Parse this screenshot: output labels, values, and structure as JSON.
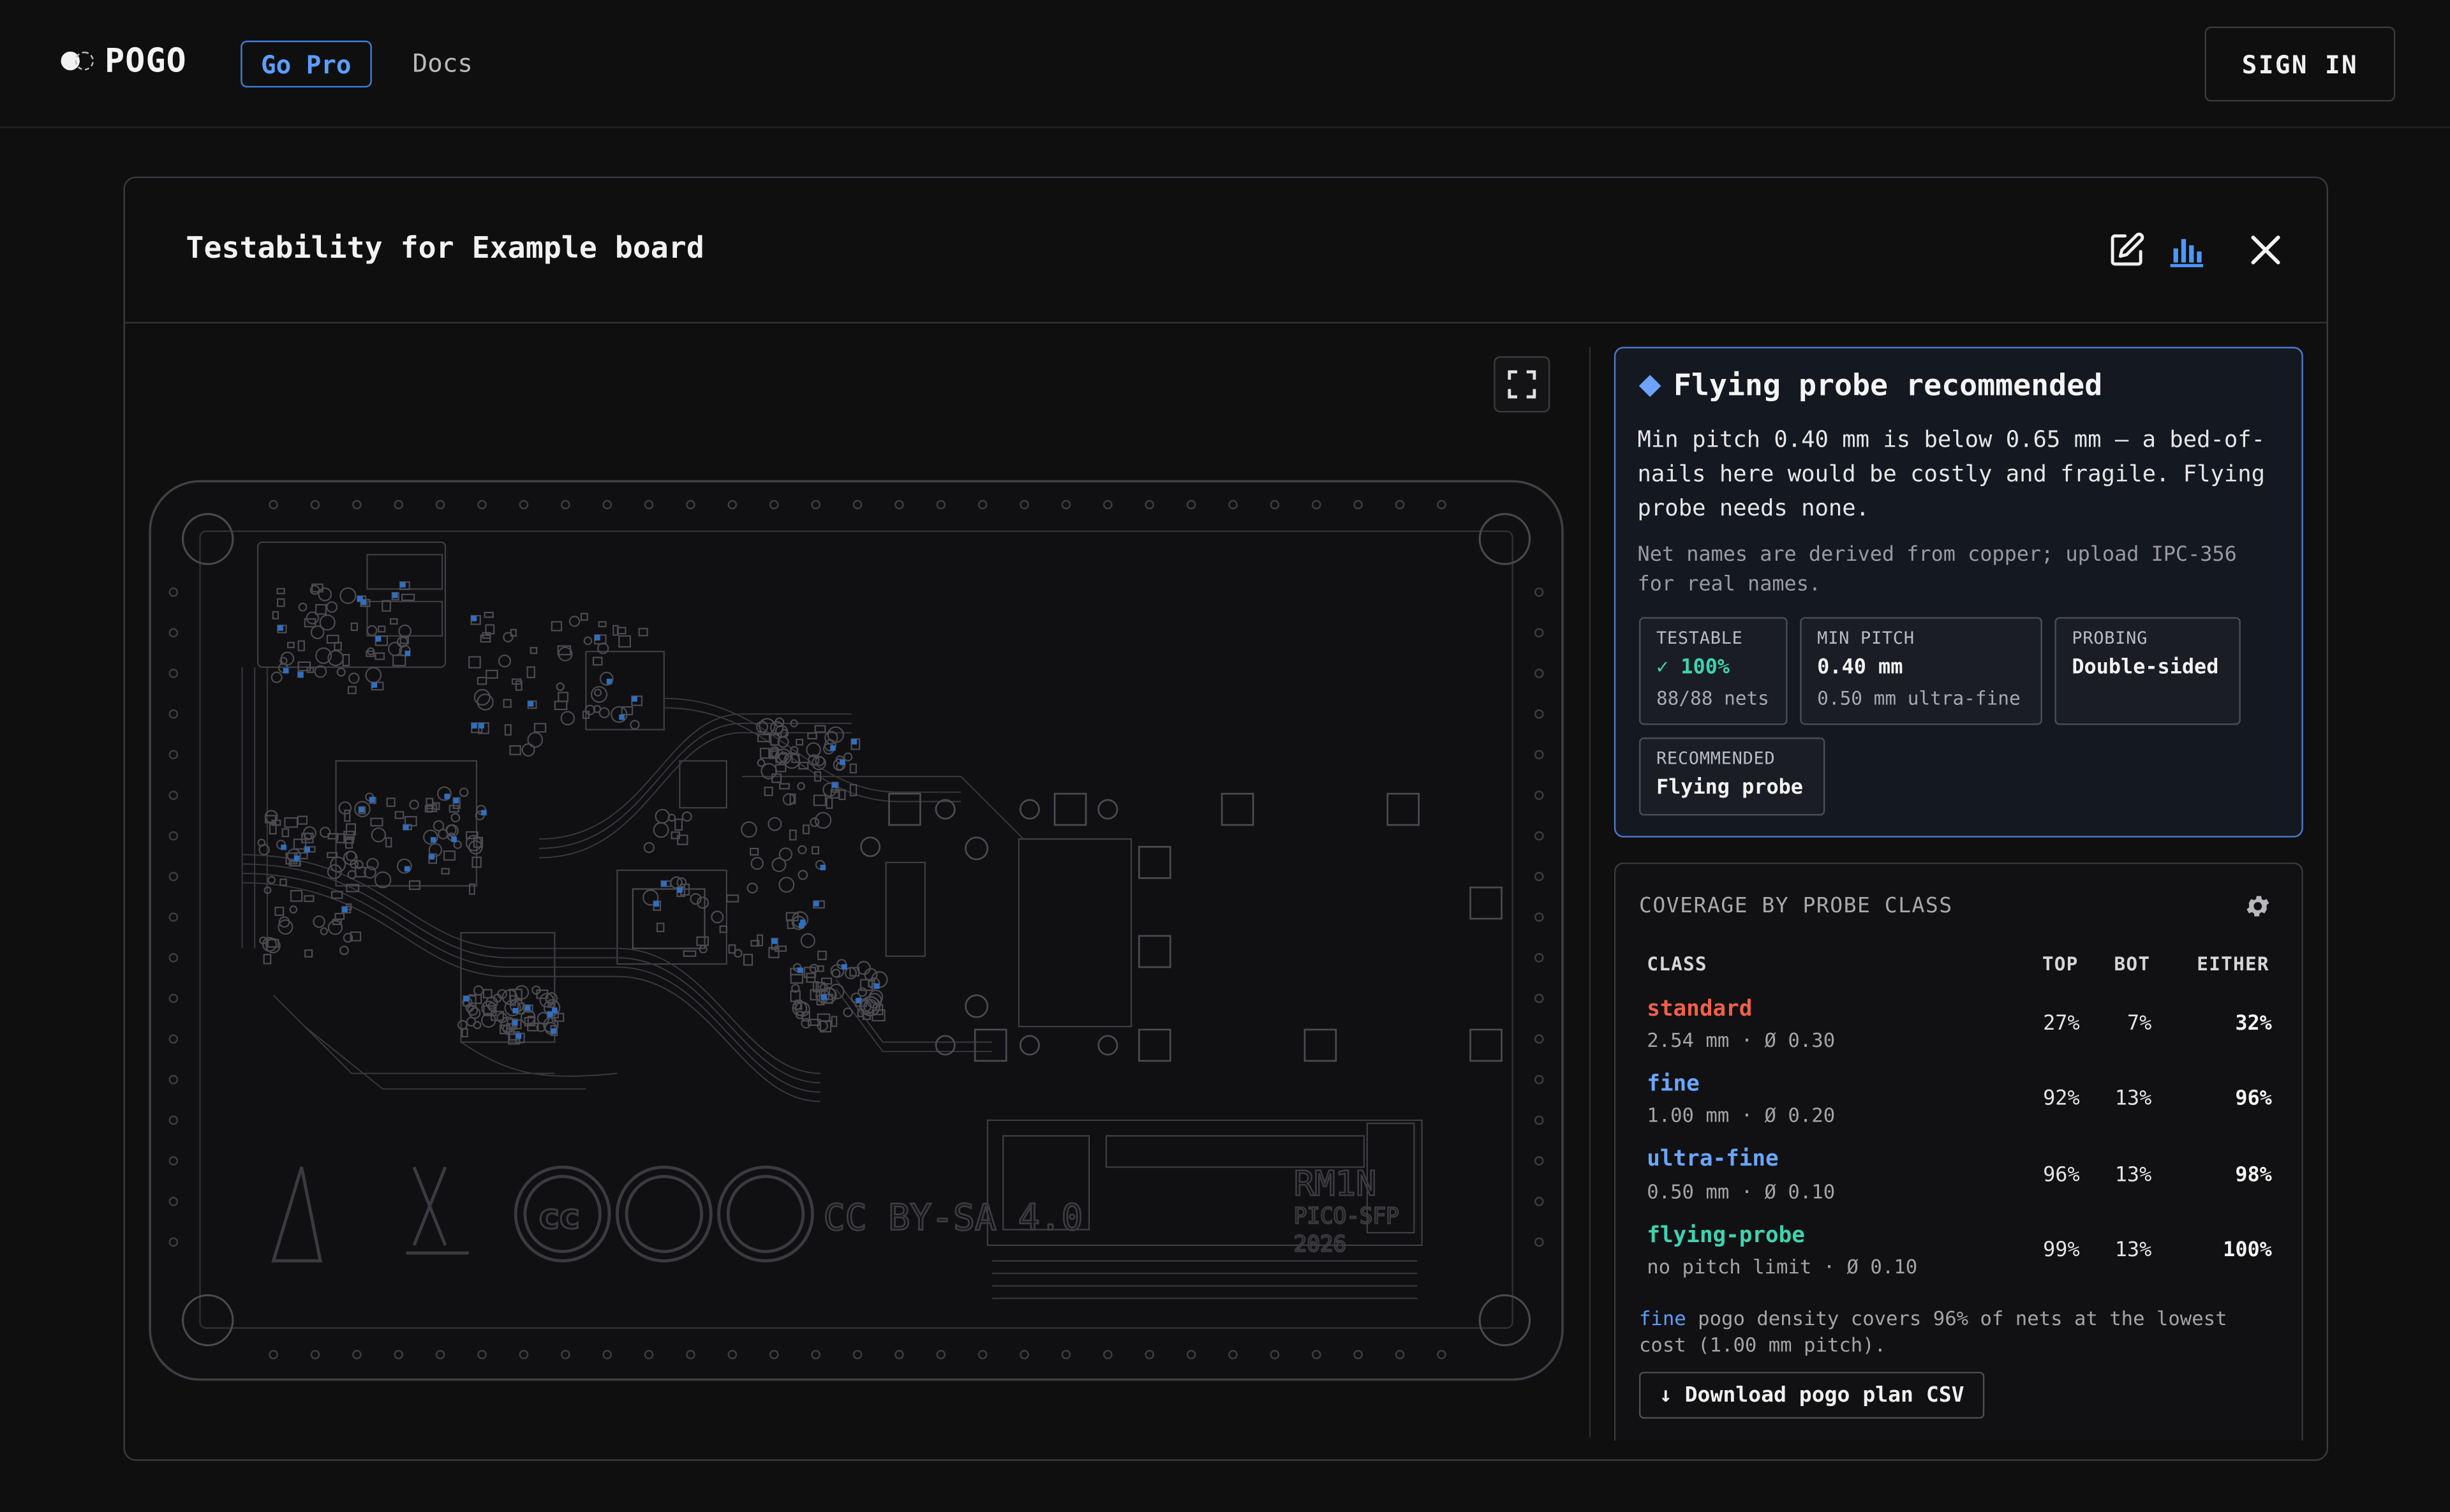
{
  "topbar": {
    "logo": "POGO",
    "go_pro": "Go Pro",
    "docs": "Docs",
    "sign_in": "SIGN IN"
  },
  "panel": {
    "title": "Testability for Example board",
    "icons": [
      "edit-icon",
      "bar-chart-icon",
      "close-icon"
    ]
  },
  "viewer": {
    "expand_icon": "expand-icon",
    "board_text": {
      "license": "CC BY-SA 4.0",
      "part": "RM1N",
      "part2": "PICO-SFP",
      "year": "2026"
    }
  },
  "recommendation": {
    "title": "Flying probe recommended",
    "body": "Min pitch 0.40 mm is below 0.65 mm — a bed-of-nails here would be costly and fragile. Flying probe needs none.",
    "note": "Net names are derived from copper; upload IPC-356 for real names.",
    "stats": [
      {
        "label": "TESTABLE",
        "value": "✓ 100%",
        "sub": "88/88 nets"
      },
      {
        "label": "MIN PITCH",
        "value": "0.40 mm",
        "sub": "0.50 mm ultra-fine"
      },
      {
        "label": "PROBING",
        "value": "Double-sided",
        "sub": ""
      },
      {
        "label": "RECOMMENDED",
        "value": "Flying probe",
        "sub": ""
      }
    ]
  },
  "coverage": {
    "title": "COVERAGE BY PROBE CLASS",
    "columns": [
      "CLASS",
      "TOP",
      "BOT",
      "EITHER"
    ],
    "rows": [
      {
        "name": "standard",
        "spec": "2.54 mm · Ø 0.30",
        "top": "27%",
        "bot": "7%",
        "either": "32%",
        "color": "#f0604a"
      },
      {
        "name": "fine",
        "spec": "1.00 mm · Ø 0.20",
        "top": "92%",
        "bot": "13%",
        "either": "96%",
        "color": "#6aa6ff"
      },
      {
        "name": "ultra-fine",
        "spec": "0.50 mm · Ø 0.10",
        "top": "96%",
        "bot": "13%",
        "either": "98%",
        "color": "#6aa6ff"
      },
      {
        "name": "flying-probe",
        "spec": "no pitch limit · Ø 0.10",
        "top": "99%",
        "bot": "13%",
        "either": "100%",
        "color": "#3ed3b0"
      }
    ],
    "footnote_highlight": "fine",
    "footnote": " pogo density covers 96% of nets at the lowest cost (1.00 mm pitch).",
    "download": "↓ Download pogo plan CSV"
  }
}
